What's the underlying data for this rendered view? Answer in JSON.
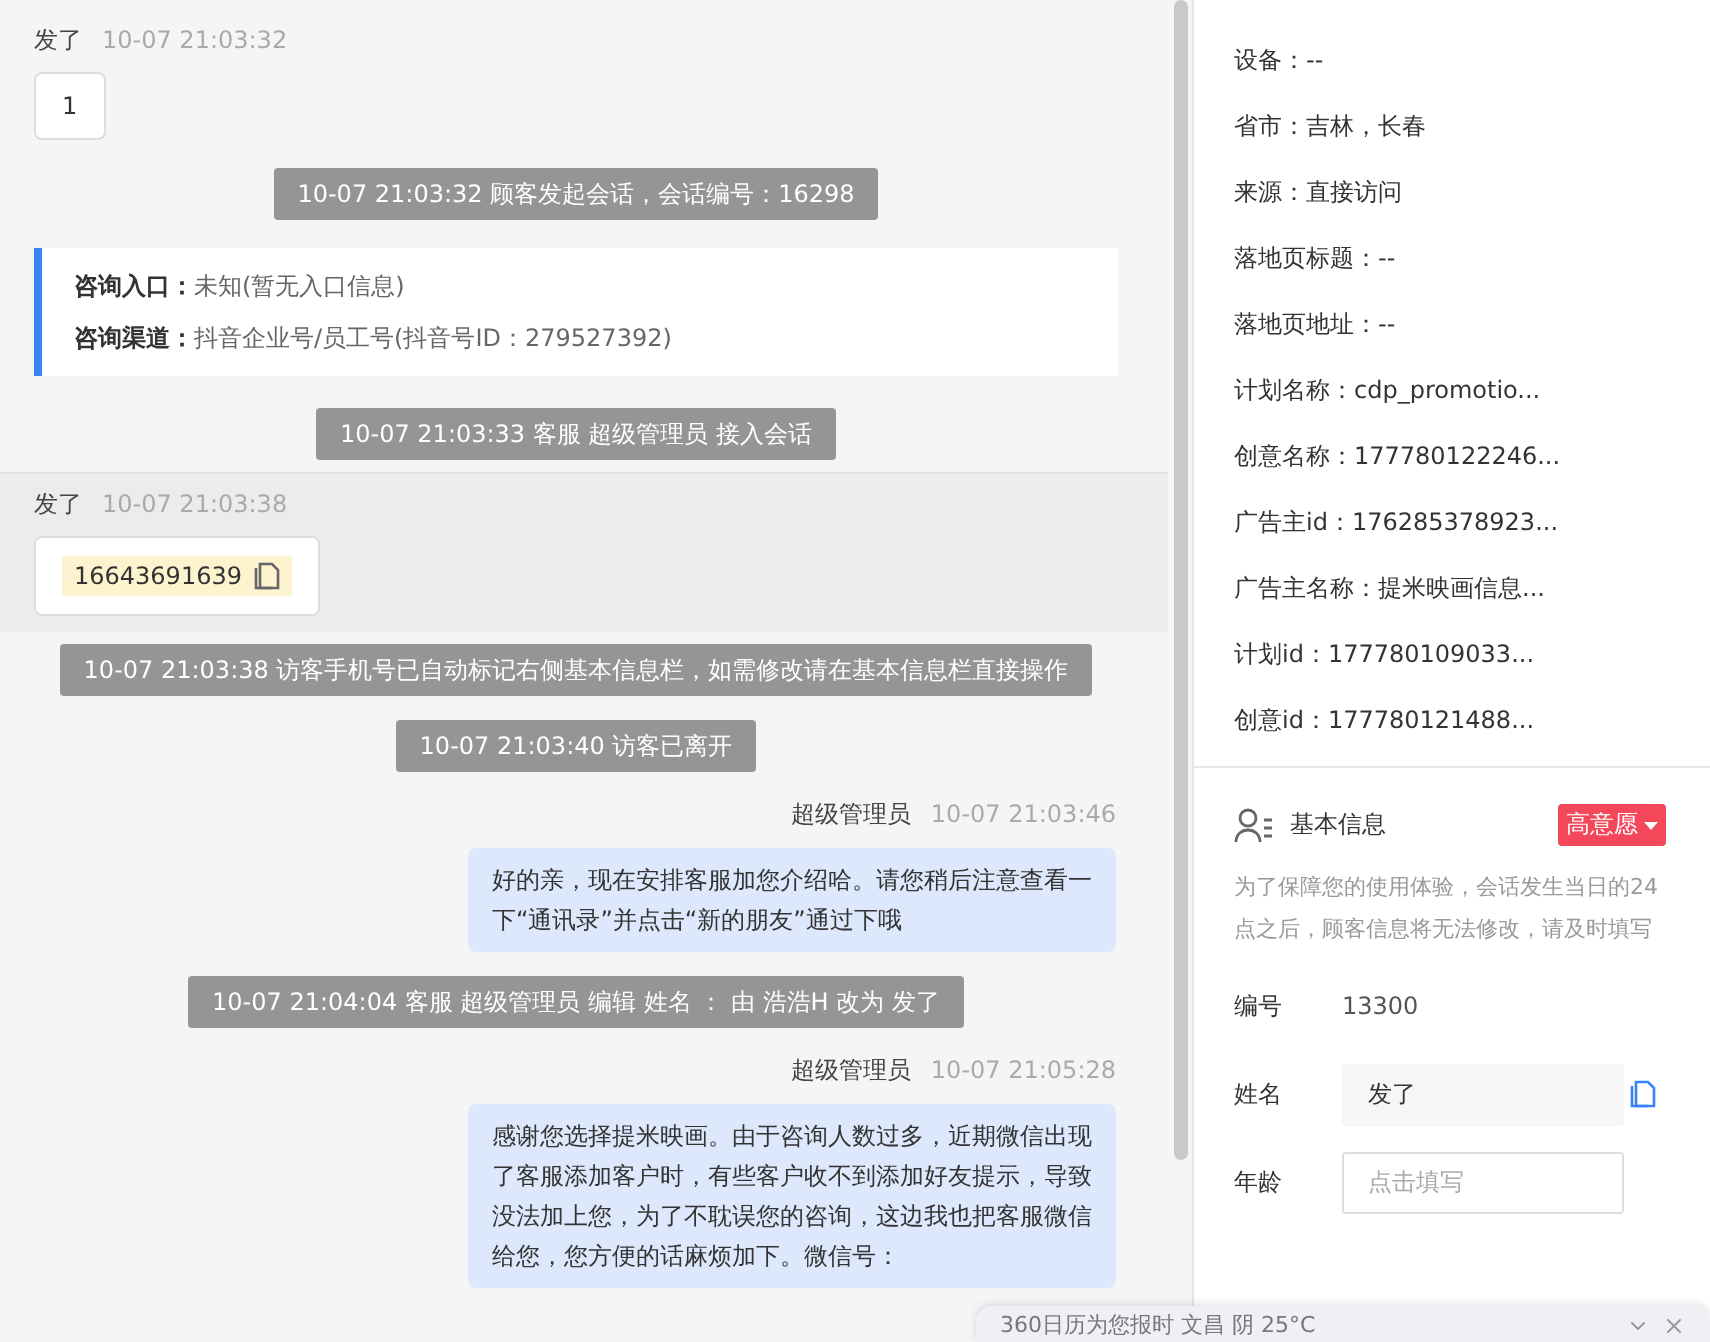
{
  "chat": {
    "messages": [
      {
        "kind": "visitor",
        "name": "发了",
        "time": "10-07 21:03:32",
        "highlighted": false,
        "content": {
          "kind": "text",
          "text": "1"
        }
      },
      {
        "kind": "system",
        "text": "10-07 21:03:32 顾客发起会话，会话编号：16298"
      },
      {
        "kind": "info_card",
        "rows": [
          {
            "label": "咨询入口：",
            "value": "未知(暂无入口信息)"
          },
          {
            "label": "咨询渠道：",
            "value": "抖音企业号/员工号(抖音号ID：279527392)"
          }
        ]
      },
      {
        "kind": "system",
        "text": "10-07 21:03:33 客服 超级管理员 接入会话"
      },
      {
        "kind": "visitor",
        "name": "发了",
        "time": "10-07 21:03:38",
        "highlighted": true,
        "content": {
          "kind": "phone",
          "text": "16643691639"
        }
      },
      {
        "kind": "system",
        "text": "10-07 21:03:38 访客手机号已自动标记右侧基本信息栏，如需修改请在基本信息栏直接操作"
      },
      {
        "kind": "system",
        "text": "10-07 21:03:40 访客已离开"
      },
      {
        "kind": "agent",
        "name": "超级管理员",
        "time": "10-07 21:03:46",
        "text": "好的亲，现在安排客服加您介绍哈。请您稍后注意查看一下“通讯录”并点击“新的朋友”通过下哦"
      },
      {
        "kind": "system",
        "text": "10-07 21:04:04 客服 超级管理员 编辑 姓名 ： 由 浩浩H 改为 发了"
      },
      {
        "kind": "agent",
        "name": "超级管理员",
        "time": "10-07 21:05:28",
        "text": "感谢您选择提米映画。由于咨询人数过多，近期微信出现了客服添加客户时，有些客户收不到添加好友提示，导致没法加上您，为了不耽误您的咨询，这边我也把客服微信给您，您方便的话麻烦加下。微信号："
      }
    ]
  },
  "sidebar": {
    "details": [
      "设备：--",
      "省市：吉林，长春",
      "来源：直接访问",
      "落地页标题：--",
      "落地页地址：--",
      "计划名称：cdp_promotio...",
      "创意名称：177780122246...",
      "广告主id：176285378923...",
      "广告主名称：提米映画信息...",
      "计划id：177780109033...",
      "创意id：177780121488..."
    ],
    "basic_info": {
      "title": "基本信息",
      "badge": "高意愿",
      "note": "为了保障您的使用体验，会话发生当日的24点之后，顾客信息将无法修改，请及时填写",
      "fields": [
        {
          "kind": "static",
          "label": "编号",
          "value": "13300"
        },
        {
          "kind": "copy_input",
          "label": "姓名",
          "value": "发了"
        },
        {
          "kind": "input",
          "label": "年龄",
          "placeholder": "点击填写"
        }
      ]
    }
  },
  "notification": {
    "text": "360日历为您报时 文昌 阴 25°C"
  }
}
